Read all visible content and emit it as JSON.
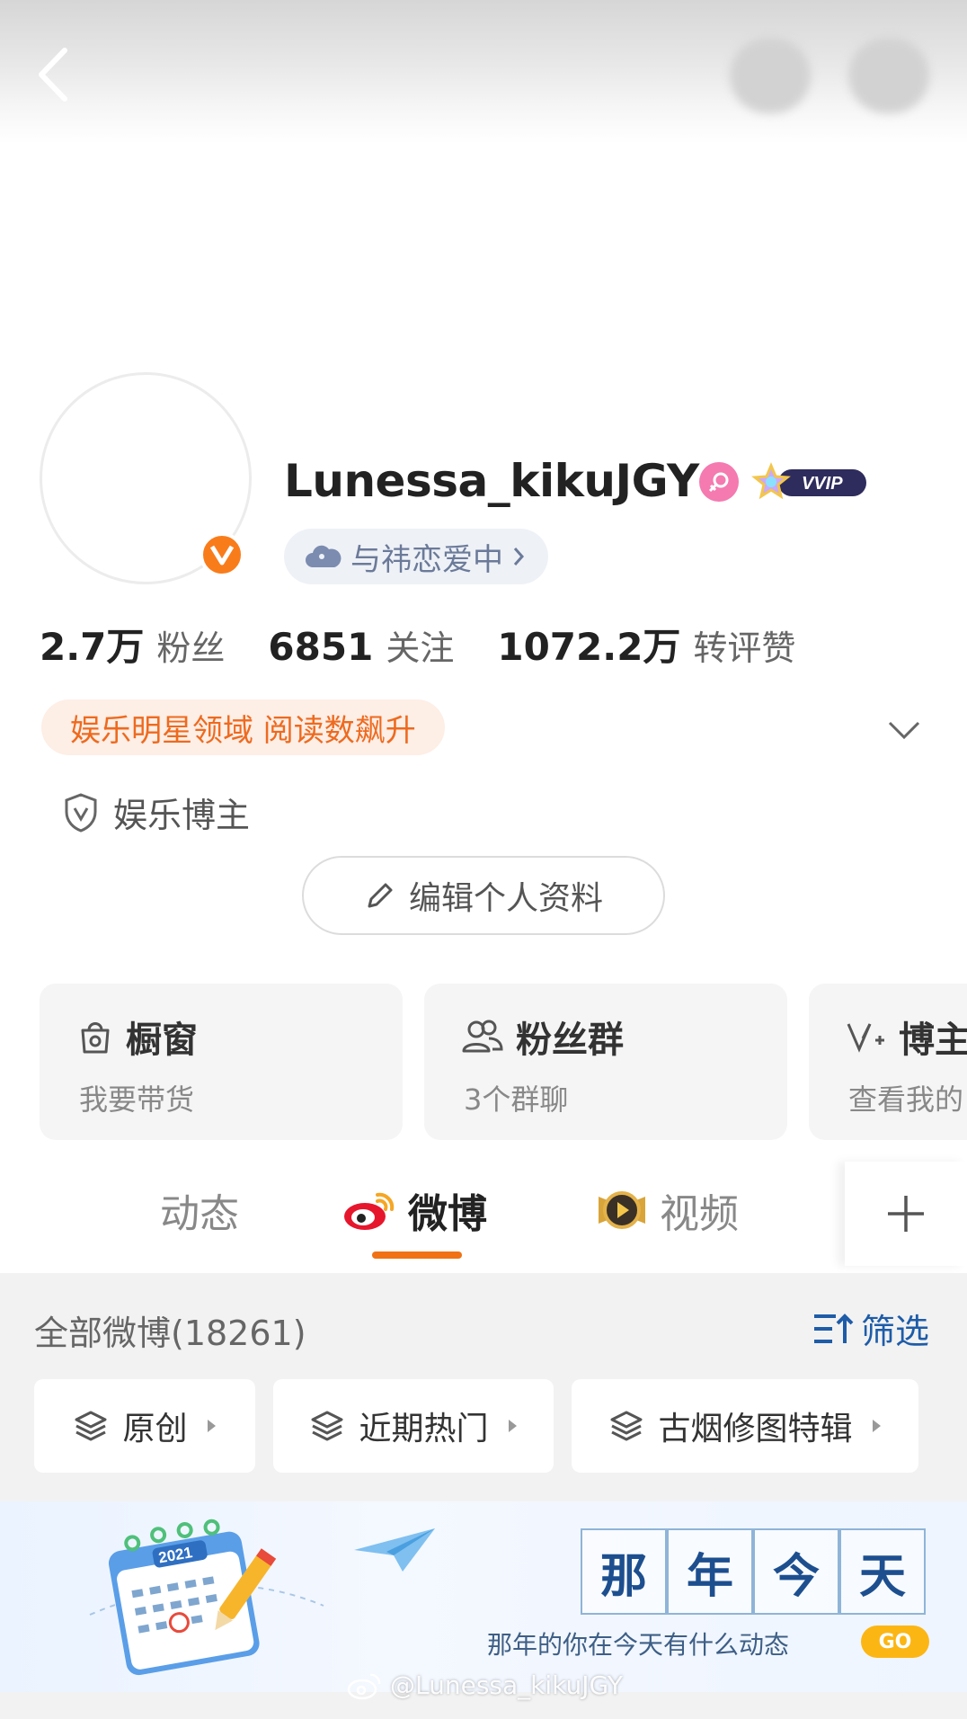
{
  "profile": {
    "username": "Lunessa_kikuJGY",
    "vip_label": "VVIP",
    "relationship": "与祎恋爱中",
    "stats": [
      {
        "value": "2.7万",
        "label": "粉丝"
      },
      {
        "value": "6851",
        "label": "关注"
      },
      {
        "value": "1072.2万",
        "label": "转评赞"
      }
    ],
    "domain_tag": "娱乐明星领域 阅读数飙升",
    "blogger_type": "娱乐博主",
    "edit_label": "编辑个人资料"
  },
  "cards": [
    {
      "title": "橱窗",
      "subtitle": "我要带货"
    },
    {
      "title": "粉丝群",
      "subtitle": "3个群聊"
    },
    {
      "title": "博主",
      "subtitle": "查看我的"
    }
  ],
  "tabs": {
    "dynamic": "动态",
    "weibo": "微博",
    "video": "视频"
  },
  "feed": {
    "count_label": "全部微博(18261)",
    "filter_label": "筛选",
    "chips": [
      "原创",
      "近期热门",
      "古烟修图特辑"
    ]
  },
  "memory_banner": {
    "chars": [
      "那",
      "年",
      "今",
      "天"
    ],
    "subtitle": "那年的你在今天有什么动态",
    "go_label": "GO",
    "calendar_year": "2021"
  },
  "watermark": "@Lunessa_kikuJGY",
  "colors": {
    "accent_orange": "#f07214",
    "verify_orange": "#f97c1b",
    "link_blue": "#1e5ca8",
    "gender_pink": "#f47ab0"
  }
}
